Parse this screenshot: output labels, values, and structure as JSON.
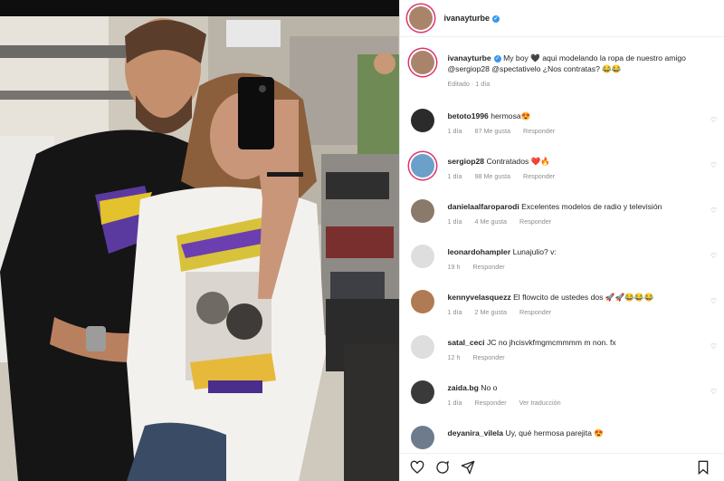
{
  "post": {
    "username": "ivanayturbe",
    "caption_text": "My boy 🖤 aqui modelando la ropa de nuestro amigo @sergiop28 @spectativelo ¿Nos contratas? 😂😂",
    "caption_meta": "Editado · 1 día"
  },
  "labels": {
    "reply": "Responder",
    "translate": "Ver traducción"
  },
  "comments": [
    {
      "user": "betoto1996",
      "text": "hermosa😍",
      "time": "1 día",
      "likes": "87 Me gusta",
      "color": "#2b2b2b"
    },
    {
      "user": "sergiop28",
      "text": "Contratados ❤️🔥",
      "time": "1 día",
      "likes": "98 Me gusta",
      "color": "#6aa0c9"
    },
    {
      "user": "danielaalfaroparodi",
      "text": "Excelentes modelos de radio y televisión",
      "time": "1 día",
      "likes": "4 Me gusta",
      "color": "#8a7a6b"
    },
    {
      "user": "leonardohampler",
      "text": "Lunajulio? v:",
      "time": "19 h",
      "likes": "",
      "color": "#d9d9d9"
    },
    {
      "user": "kennyvelasquezz",
      "text": "El flowcito de ustedes dos 🚀🚀😂😂😂",
      "time": "1 día",
      "likes": "2 Me gusta",
      "color": "#b07a55"
    },
    {
      "user": "satal_ceci",
      "text": "JC no jhcisvkfmgmcmmmm m non. fx",
      "time": "12 h",
      "likes": "",
      "color": "#d9d9d9"
    },
    {
      "user": "zaida.bg",
      "text": "No o",
      "time": "1 día",
      "likes": "",
      "color": "#3a3a3a"
    },
    {
      "user": "deyanira_vilela",
      "text": "Uy, qué hermosa parejita 😍",
      "time": "",
      "likes": "",
      "color": "#6e7b8c"
    }
  ],
  "icons": [
    "heart-icon",
    "comment-icon",
    "share-icon",
    "bookmark-icon",
    "verified-icon"
  ]
}
